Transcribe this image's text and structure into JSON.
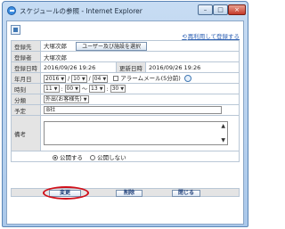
{
  "window": {
    "title": "スケジュールの参照 - Internet Explorer",
    "minimize_label": "–",
    "maximize_label": "□",
    "close_label": "×"
  },
  "nav": {
    "arrow": "⟲",
    "link_label": "再利用して登録する"
  },
  "form": {
    "registrant": {
      "label": "登録先",
      "value": "大塚次郎",
      "button_label": "ユーザー及び施設を選択"
    },
    "registered_by": {
      "label": "登録者",
      "value": "大塚次郎"
    },
    "created": {
      "label": "登録日時",
      "value": "2016/09/26 19:26",
      "updated_label": "更新日時",
      "updated_value": "2016/09/26 19:26"
    },
    "date": {
      "label": "年月日",
      "year": "2016",
      "month": "10",
      "day": "04",
      "alarm_label": "アラームメール(5分前)"
    },
    "time": {
      "label": "時刻",
      "start_hour": "11",
      "start_min": "00",
      "end_hour": "13",
      "end_min": "30",
      "sep_colon": ":",
      "sep_tilde": "～",
      "sep_slash": "/"
    },
    "category": {
      "label": "分類",
      "value": "外出(お客様先)"
    },
    "subject": {
      "label": "予定",
      "value": "B社"
    },
    "notes": {
      "label": "備考",
      "value": ""
    },
    "visibility": {
      "public_label": "公開する",
      "private_label": "公開しない",
      "selected": "public"
    }
  },
  "actions": {
    "change_label": "変更",
    "delete_label": "削除",
    "close_label": "閉じる"
  },
  "colors": {
    "highlight": "#d0101a",
    "link": "#2f62b4"
  }
}
